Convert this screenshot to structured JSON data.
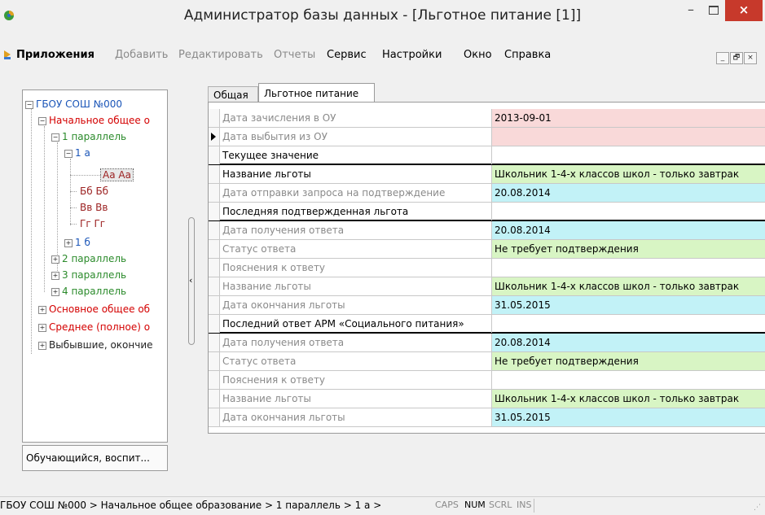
{
  "window": {
    "title": "Администратор базы данных - [Льготное питание [1]]",
    "close_label": "×",
    "minimize_label": "–"
  },
  "menu": {
    "items": [
      {
        "label": "Приложения",
        "enabled": true
      },
      {
        "label": "Добавить",
        "enabled": false
      },
      {
        "label": "Редактировать",
        "enabled": false
      },
      {
        "label": "Отчеты",
        "enabled": false
      },
      {
        "label": "Сервис",
        "enabled": true
      },
      {
        "label": "Настройки",
        "enabled": true
      },
      {
        "label": "Окно",
        "enabled": true
      },
      {
        "label": "Справка",
        "enabled": true
      }
    ],
    "mdi_buttons": [
      "_",
      "🗗",
      "×"
    ]
  },
  "tree": {
    "root": "ГБОУ СОШ №000",
    "nodes": [
      {
        "label": "Начальное общее о",
        "color": "red",
        "expander": "−"
      },
      {
        "label": "1 параллель",
        "color": "green",
        "expander": "−"
      },
      {
        "label": "1 а",
        "color": "blue",
        "expander": "−"
      },
      {
        "label": "Аа Аа",
        "color": "darkred",
        "selected": true
      },
      {
        "label": "Бб Бб",
        "color": "darkred"
      },
      {
        "label": "Вв Вв",
        "color": "darkred"
      },
      {
        "label": "Гг Гг",
        "color": "darkred"
      },
      {
        "label": "1 б",
        "color": "blue",
        "expander": "+"
      },
      {
        "label": "2 параллель",
        "color": "green",
        "expander": "+"
      },
      {
        "label": "3 параллель",
        "color": "green",
        "expander": "+"
      },
      {
        "label": "4 параллель",
        "color": "green",
        "expander": "+"
      },
      {
        "label": "Основное общее об",
        "color": "red",
        "expander": "+"
      },
      {
        "label": "Среднее (полное) о",
        "color": "red",
        "expander": "+"
      },
      {
        "label": "Выбывшие, окончие",
        "color": "dark",
        "expander": "+"
      }
    ],
    "bottom_button": "Обучающийся, воспит..."
  },
  "tabs": [
    {
      "label": "Общая",
      "active": false
    },
    {
      "label": "Льготное питание",
      "active": true
    }
  ],
  "grid": {
    "rows": [
      {
        "label": "Дата зачисления в ОУ",
        "value": "2013-09-01",
        "bg": "pink"
      },
      {
        "label": "Дата выбытия из ОУ",
        "value": "",
        "bg": "pink",
        "current": true
      },
      {
        "label": "Текущее значение",
        "value": "",
        "bg": "white",
        "header": true
      },
      {
        "label": "Название льготы",
        "value": "Школьник 1-4-х классов школ - только завтрак",
        "bg": "green",
        "dark": true
      },
      {
        "label": "Дата отправки запроса на подтверждение",
        "value": "20.08.2014",
        "bg": "cyan"
      },
      {
        "label": "Последняя подтвержденная льгота",
        "value": "",
        "bg": "white",
        "header": true
      },
      {
        "label": "Дата получения ответа",
        "value": "20.08.2014",
        "bg": "cyan"
      },
      {
        "label": "Статус ответа",
        "value": "Не требует подтверждения",
        "bg": "green"
      },
      {
        "label": "Пояснения к ответу",
        "value": "",
        "bg": "white"
      },
      {
        "label": "Название льготы",
        "value": "Школьник 1-4-х классов школ - только завтрак",
        "bg": "green"
      },
      {
        "label": "Дата окончания льготы",
        "value": "31.05.2015",
        "bg": "cyan"
      },
      {
        "label": "Последний ответ АРМ «Социального питания»",
        "value": "",
        "bg": "white",
        "header": true
      },
      {
        "label": "Дата получения ответа",
        "value": "20.08.2014",
        "bg": "cyan"
      },
      {
        "label": "Статус ответа",
        "value": "Не требует подтверждения",
        "bg": "green"
      },
      {
        "label": "Пояснения к ответу",
        "value": "",
        "bg": "white"
      },
      {
        "label": "Название льготы",
        "value": "Школьник 1-4-х классов школ - только завтрак",
        "bg": "green"
      },
      {
        "label": "Дата окончания льготы",
        "value": "31.05.2015",
        "bg": "cyan"
      }
    ]
  },
  "status": {
    "path": "ГБОУ СОШ №000 > Начальное общее образование > 1 параллель > 1 а >",
    "indicators": [
      {
        "label": "CAPS",
        "on": false
      },
      {
        "label": "NUM",
        "on": true
      },
      {
        "label": "SCRL",
        "on": false
      },
      {
        "label": "INS",
        "on": false
      }
    ]
  },
  "colors": {
    "pink": "#f9d9d9",
    "cyan": "#c2f2f7",
    "green": "#d8f5c4",
    "close": "#c7392b"
  }
}
